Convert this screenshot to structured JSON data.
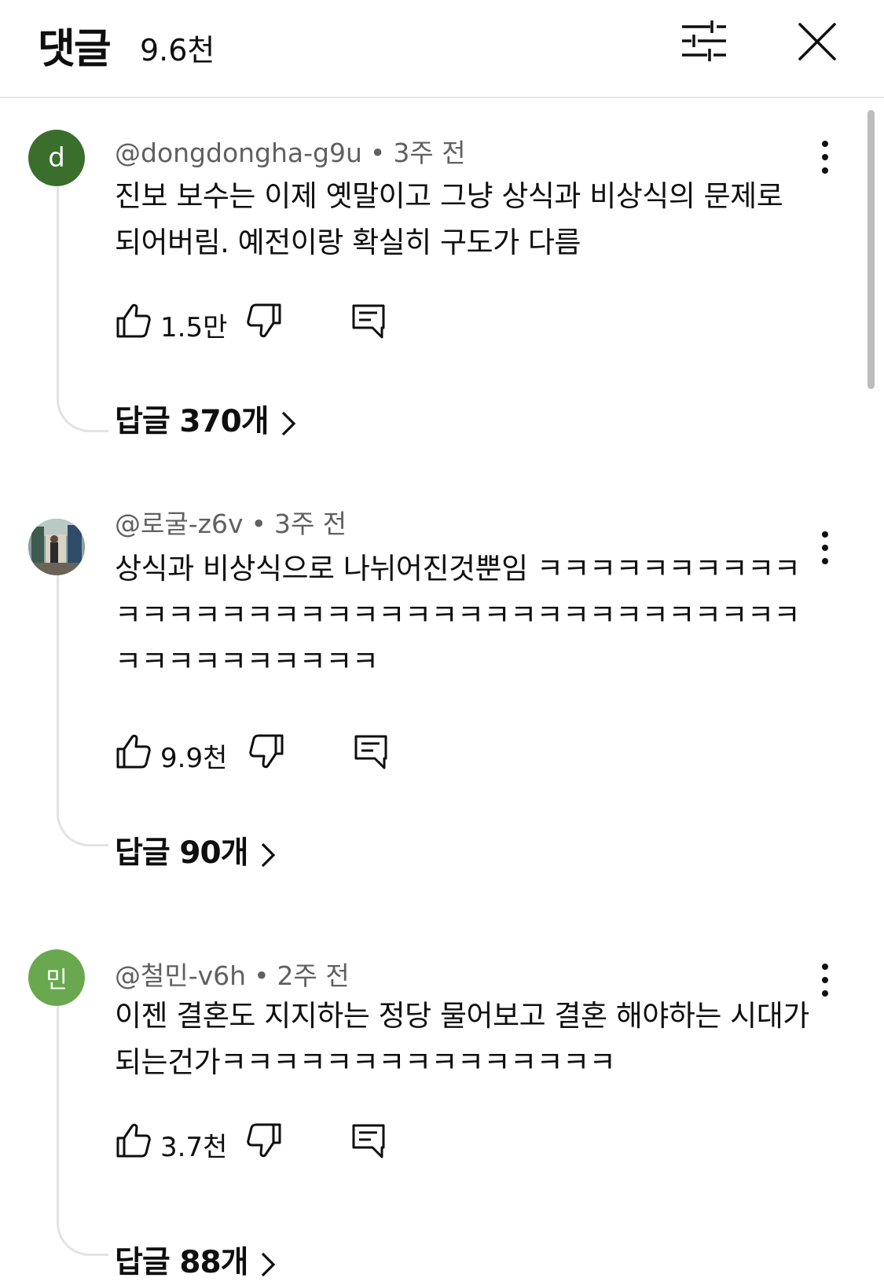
{
  "header": {
    "title": "댓글",
    "count": "9.6천"
  },
  "comments": [
    {
      "avatar_letter": "d",
      "avatar_color": "#3a6e2c",
      "author": "@dongdongha-g9u",
      "time": "3주 전",
      "text": "진보 보수는 이제 옛말이고 그냥 상식과 비상식의 문제로 되어버림. 예전이랑 확실히 구도가 다름",
      "likes": "1.5만",
      "replies": "답글 370개"
    },
    {
      "avatar_letter": "",
      "avatar_color": "#6f8a7a",
      "author": "@로굴-z6v",
      "time": "3주 전",
      "text": "상식과 비상식으로 나뉘어진것뿐임 ㅋㅋㅋㅋㅋㅋㅋㅋㅋㅋㅋㅋㅋㅋㅋㅋㅋㅋㅋㅋㅋㅋㅋㅋㅋㅋㅋㅋㅋㅋㅋㅋㅋㅋㅋㅋㅋㅋㅋㅋㅋㅋㅋㅋㅋㅋ",
      "likes": "9.9천",
      "replies": "답글 90개"
    },
    {
      "avatar_letter": "민",
      "avatar_color": "#6aa84f",
      "author": "@철민-v6h",
      "time": "2주 전",
      "text": "이젠 결혼도 지지하는 정당 물어보고 결혼 해야하는 시대가 되는건가ㅋㅋㅋㅋㅋㅋㅋㅋㅋㅋㅋㅋㅋㅋㅋ",
      "likes": "3.7천",
      "replies": "답글 88개"
    }
  ],
  "icons": {
    "filter": "filter-sliders-icon",
    "close": "close-icon",
    "more": "more-vertical-icon",
    "like": "thumbs-up-icon",
    "dislike": "thumbs-down-icon",
    "reply": "comment-reply-icon",
    "chevron": "chevron-right-icon"
  }
}
